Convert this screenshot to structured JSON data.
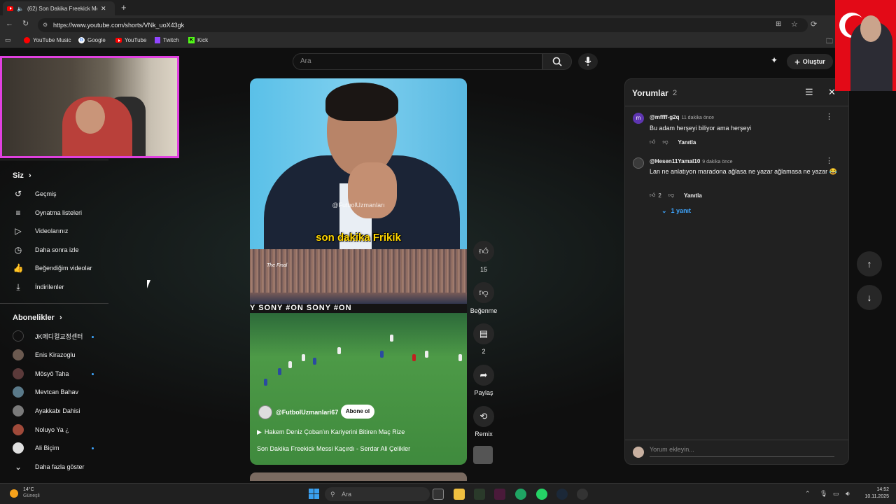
{
  "browser": {
    "tab_title": "(62) Son Dakika Freekick Me",
    "url": "https://www.youtube.com/shorts/VNk_uoX43gk",
    "bookmarks": [
      "YouTube Music",
      "Google",
      "YouTube",
      "Twitch",
      "Kick"
    ]
  },
  "header": {
    "search_placeholder": "Ara",
    "create_label": "Oluştur"
  },
  "sidebar": {
    "you_heading": "Siz",
    "you_items": [
      {
        "label": "Geçmiş",
        "icon": "history-icon"
      },
      {
        "label": "Oynatma listeleri",
        "icon": "playlist-icon"
      },
      {
        "label": "Videolarınız",
        "icon": "your-videos-icon"
      },
      {
        "label": "Daha sonra izle",
        "icon": "watch-later-icon"
      },
      {
        "label": "Beğendiğim videolar",
        "icon": "liked-videos-icon"
      },
      {
        "label": "İndirilenler",
        "icon": "download-icon"
      }
    ],
    "subs_heading": "Abonelikler",
    "subscriptions": [
      {
        "label": "JK메디컬교정센터",
        "avatar_color": "#111111",
        "new": true
      },
      {
        "label": "Enis Kirazoglu",
        "avatar_color": "#6b5a50",
        "new": false
      },
      {
        "label": "Mösyö Taha",
        "avatar_color": "#5b3a3a",
        "new": true
      },
      {
        "label": "Mevtcan Bahav",
        "avatar_color": "#5a7a8a",
        "new": false
      },
      {
        "label": "Ayakkabı Dahisi",
        "avatar_color": "#7a7a7a",
        "new": false
      },
      {
        "label": "Noluyo Ya ¿",
        "avatar_color": "#a04a3a",
        "new": false
      },
      {
        "label": "Ali Biçim",
        "avatar_color": "#e0e0e0",
        "new": true
      }
    ],
    "show_more": "Daha fazla göster"
  },
  "video": {
    "watermark": "@FutbolUzmanları",
    "caption": "son dakika Frikik",
    "stadium_label": "The Final",
    "adboard_text": "Y  SONY  #ON  SONY  #ON",
    "channel": "@FutbolUzmanlari67",
    "subscribe_label": "Abone ol",
    "related_link": "Hakem Deniz Çoban'ın Kariyerini Bitiren Maç Rize",
    "title": "Son Dakika Freekick Messi Kaçırdı - Serdar Ali Çelikler"
  },
  "actions": {
    "like_count": "15",
    "dislike_label": "Beğenme",
    "comment_count": "2",
    "share_label": "Paylaş",
    "remix_label": "Remix"
  },
  "comments": {
    "title": "Yorumlar",
    "count": "2",
    "items": [
      {
        "author": "@mffff-g2q",
        "time": "11 dakika önce",
        "text": "Bu adam herşeyi biliyor ama herşeyi",
        "likes": "",
        "reply": "Yanıtla",
        "avatar_letter": "m"
      },
      {
        "author": "@Hesen11Yamal10",
        "time": "9 dakika önce",
        "text": "Lan ne anlatıyon maradona ağlasa ne yazar ağlamasa ne yazar 😂",
        "likes": "2",
        "reply": "Yanıtla",
        "avatar_letter": ""
      }
    ],
    "replies_toggle": "1 yanıt",
    "add_placeholder": "Yorum ekleyin..."
  },
  "taskbar": {
    "temperature": "14°C",
    "weather": "Güneşli",
    "search_placeholder": "Ara",
    "time": "14:52",
    "date": "10.11.2025"
  },
  "colors": {
    "webcam_border": "#e040e0",
    "link_blue": "#3ea6ff",
    "caption_yellow": "#ffd600",
    "flag_red": "#e30a17"
  }
}
